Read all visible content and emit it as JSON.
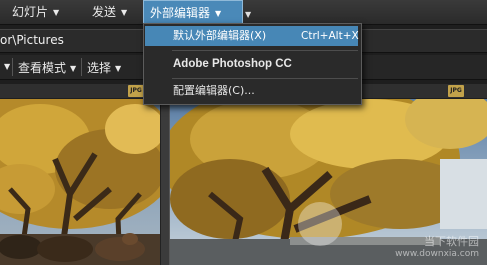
{
  "menubar": {
    "slideshow": "幻灯片",
    "send": "发送",
    "external_editor": "外部编辑器"
  },
  "path": "or\\Pictures",
  "toolbar": {
    "view_mode": "查看模式",
    "select": "选择"
  },
  "badge": "JPG",
  "dropdown": {
    "default_editor": "默认外部编辑器(X)",
    "default_editor_shortcut": "Ctrl+Alt+X",
    "photoshop": "Adobe Photoshop CC",
    "configure": "配置编辑器(C)..."
  },
  "watermark": {
    "line1": "当下软件园",
    "line2": "www.downxia.com"
  },
  "colors": {
    "accent": "#4787b6",
    "menubar": "#2f2f2f",
    "background": "#1e1e1e"
  }
}
